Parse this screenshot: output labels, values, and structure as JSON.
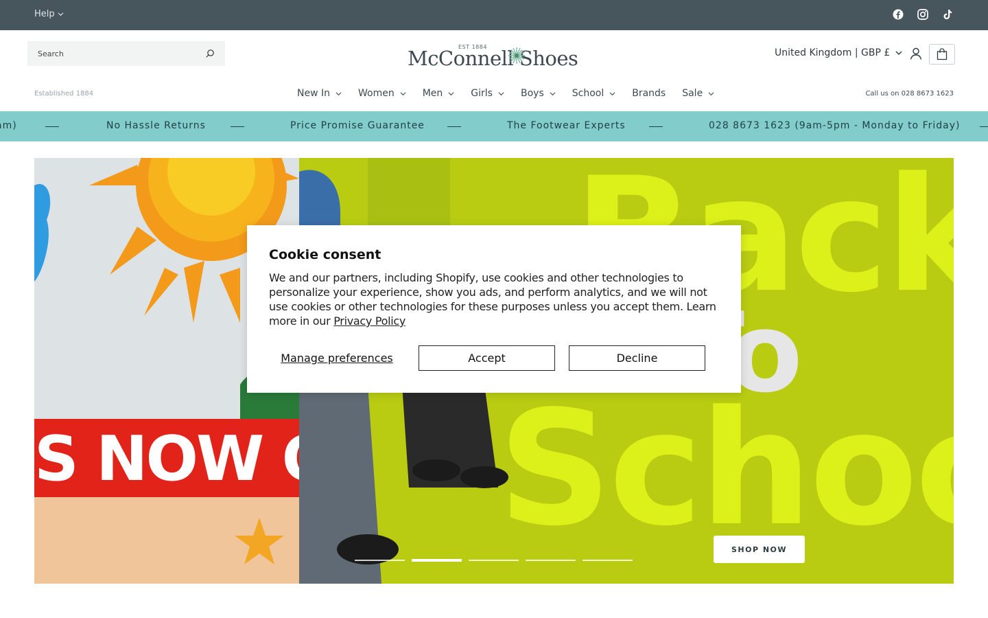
{
  "topbar": {
    "help_label": "Help",
    "socials": [
      "facebook-icon",
      "instagram-icon",
      "tiktok-icon"
    ]
  },
  "header": {
    "search_placeholder": "Search",
    "logo_est": "EST 1884",
    "logo_name": "McConnell Shoes",
    "region": "United Kingdom | GBP £",
    "established": "Established 1884",
    "callus": "Call us on 028 8673 1623"
  },
  "nav": {
    "items": [
      {
        "label": "New In",
        "dropdown": true
      },
      {
        "label": "Women",
        "dropdown": true
      },
      {
        "label": "Men",
        "dropdown": true
      },
      {
        "label": "Girls",
        "dropdown": true
      },
      {
        "label": "Boys",
        "dropdown": true
      },
      {
        "label": "School",
        "dropdown": true
      },
      {
        "label": "Brands",
        "dropdown": false
      },
      {
        "label": "Sale",
        "dropdown": true
      }
    ]
  },
  "marquee": {
    "items": [
      "am)",
      "No Hassle Returns",
      "Price Promise Guarantee",
      "The Footwear Experts",
      "028 8673 1623 (9am-5pm - Monday to Friday)"
    ]
  },
  "hero": {
    "left_banner_text": "S NOW O",
    "right_words": [
      "Back",
      "To",
      "School"
    ],
    "shop_now": "SHOP NOW",
    "slide_count": 5,
    "active_slide": 2
  },
  "cookie": {
    "title": "Cookie consent",
    "body": "We and our partners, including Shopify, use cookies and other technologies to personalize your experience, show you ads, and perform analytics, and we will not use cookies or other technologies for these purposes unless you accept them. Learn more in our",
    "policy_link": "Privacy Policy",
    "manage": "Manage preferences",
    "accept": "Accept",
    "decline": "Decline"
  },
  "colors": {
    "topbar": "#47555c",
    "marquee": "#82cdcb",
    "hero_green": "#b9cc12",
    "banner_red": "#e2231a"
  }
}
